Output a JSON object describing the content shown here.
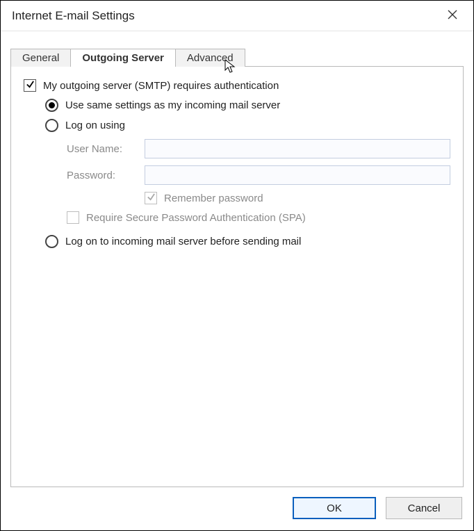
{
  "dialog": {
    "title": "Internet E-mail Settings"
  },
  "tabs": {
    "general": "General",
    "outgoing": "Outgoing Server",
    "advanced": "Advanced"
  },
  "auth": {
    "requires_auth": "My outgoing server (SMTP) requires authentication",
    "use_same": "Use same settings as my incoming mail server",
    "log_on_using": "Log on using",
    "user_name_label": "User Name:",
    "user_name_value": "",
    "password_label": "Password:",
    "password_value": "",
    "remember_password": "Remember password",
    "require_spa": "Require Secure Password Authentication (SPA)",
    "log_on_incoming": "Log on to incoming mail server before sending mail"
  },
  "buttons": {
    "ok": "OK",
    "cancel": "Cancel"
  }
}
